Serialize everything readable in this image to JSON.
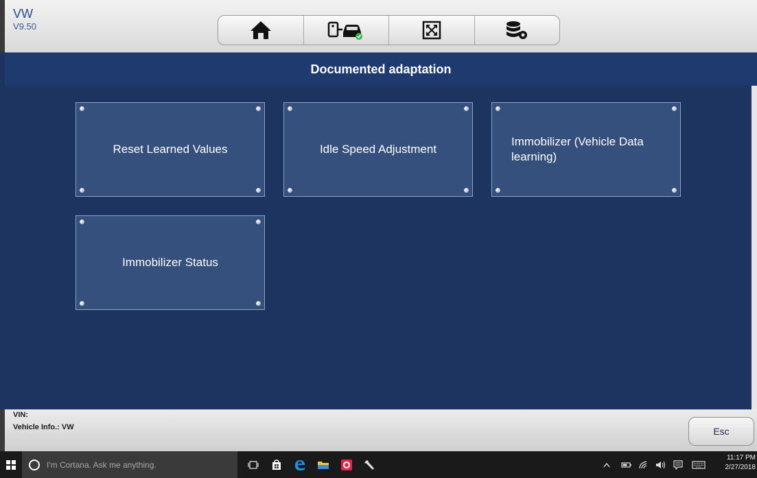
{
  "header": {
    "make": "VW",
    "version": "V9.50",
    "toolbar": [
      {
        "icon": "home-icon"
      },
      {
        "icon": "vehicle-connect-icon"
      },
      {
        "icon": "fullscreen-icon"
      },
      {
        "icon": "data-settings-icon"
      }
    ]
  },
  "page_title": "Documented adaptation",
  "tiles": [
    {
      "label": "Reset Learned Values"
    },
    {
      "label": "Idle Speed Adjustment"
    },
    {
      "label": "Immobilizer (Vehicle Data learning)"
    },
    {
      "label": "Immobilizer Status"
    }
  ],
  "footer": {
    "vin_label": "VIN:",
    "vehicle_info": "Vehicle Info.: VW",
    "esc_label": "Esc"
  },
  "taskbar": {
    "search_placeholder": "I'm Cortana. Ask me anything.",
    "time": "11:17 PM",
    "date": "2/27/2018"
  },
  "colors": {
    "background": "#1d3461",
    "tile": "#36507e",
    "brand": "#2a4a8a"
  }
}
